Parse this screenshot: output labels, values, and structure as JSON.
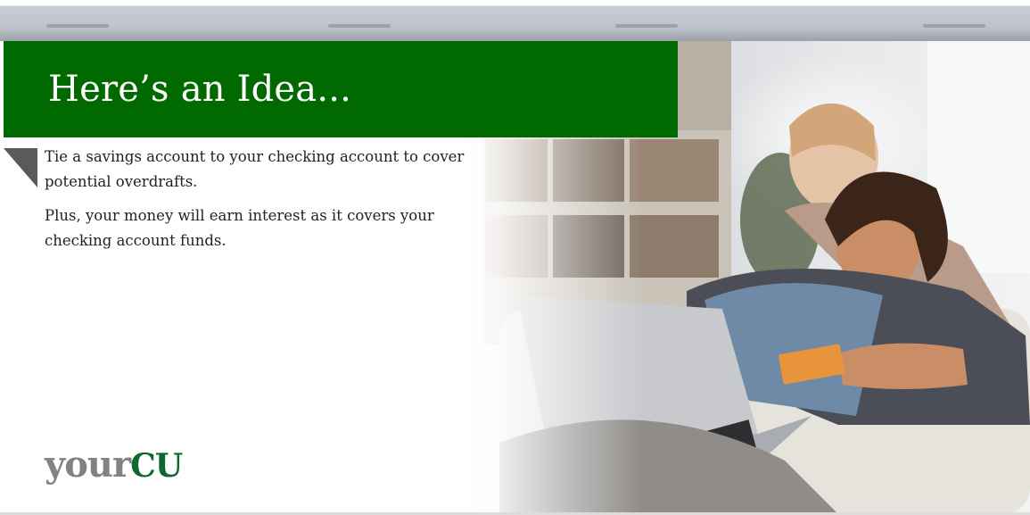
{
  "banner": {
    "headline": "Here’s an Idea..."
  },
  "body": {
    "paragraph_1": "Tie a savings account to your checking account to cover potential overdrafts.",
    "paragraph_2": "Plus, your money will earn interest as it covers your checking account funds."
  },
  "logo": {
    "part_1": "your",
    "part_2": "CU"
  },
  "colors": {
    "banner_green": "#006a00",
    "logo_gray": "#808285",
    "logo_green": "#0b6a2f",
    "corner_gray": "#5a5a5a"
  },
  "icons": {
    "photo": "two-women-laptop-credit-card-photo",
    "corner": "folded-corner-triangle"
  }
}
